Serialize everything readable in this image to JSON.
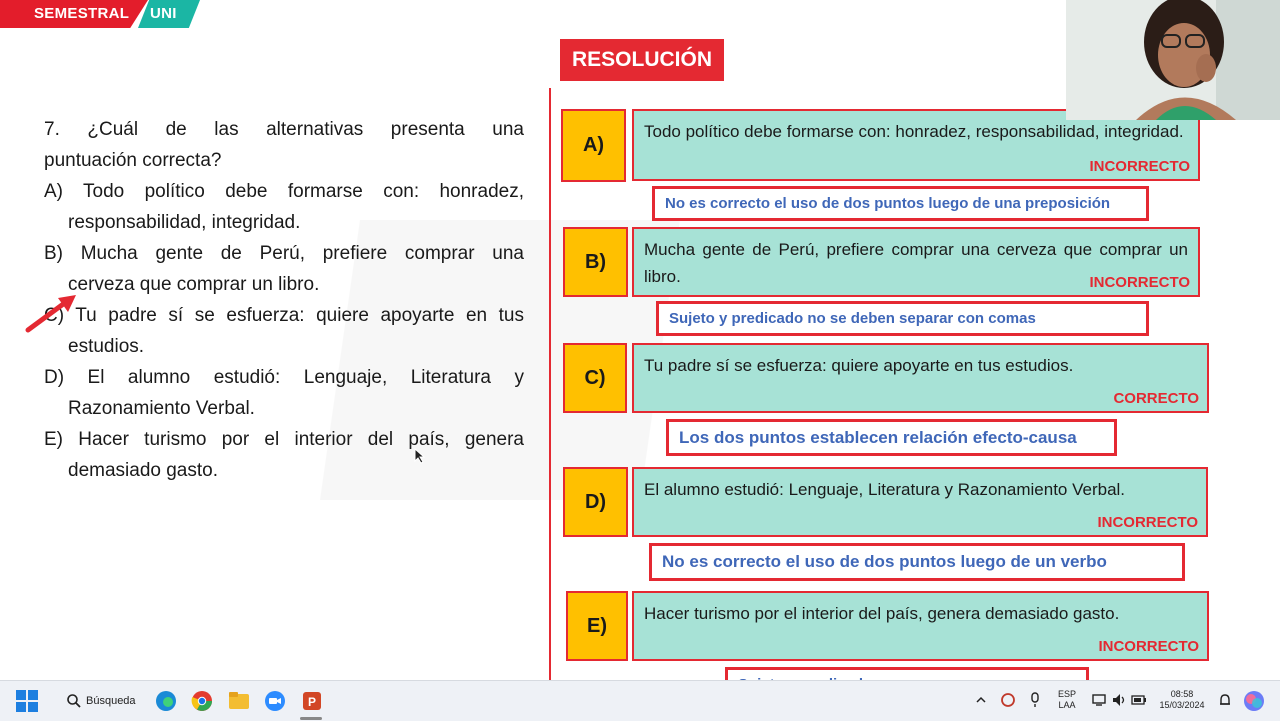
{
  "header": {
    "brand_left": "SEMESTRAL",
    "brand_right": "UNI"
  },
  "question": {
    "lines": [
      "7. ¿Cuál de las alternativas presenta una",
      "puntuación correcta?",
      "A) Todo político debe formarse con: honradez,",
      "responsabilidad, integridad.",
      "B) Mucha gente de Perú, prefiere comprar una",
      "cerveza que comprar un libro.",
      "C) Tu padre sí se esfuerza: quiere apoyarte en tus",
      "estudios.",
      "D) El alumno estudió: Lenguaje, Literatura y",
      "Razonamiento Verbal.",
      "E) Hacer turismo por el interior del país, genera",
      "demasiado gasto."
    ]
  },
  "resolution": {
    "title": "RESOLUCIÓN",
    "options": [
      {
        "letter": "A)",
        "text": "Todo político debe formarse con: honradez, responsabilidad, integridad.",
        "verdict": "INCORRECTO",
        "note": "No es correcto el uso de dos puntos luego de una preposición"
      },
      {
        "letter": "B)",
        "text": "Mucha gente de Perú, prefiere comprar una cerveza que comprar un libro.",
        "verdict": "INCORRECTO",
        "note": "Sujeto y predicado no se deben separar con comas"
      },
      {
        "letter": "C)",
        "text": "Tu padre sí se esfuerza: quiere apoyarte en tus estudios.",
        "verdict": "CORRECTO",
        "note": "Los dos puntos establecen relación efecto-causa"
      },
      {
        "letter": "D)",
        "text": "El alumno estudió: Lenguaje, Literatura y Razonamiento Verbal.",
        "verdict": "INCORRECTO",
        "note": "No es correcto el uso de dos puntos luego de un verbo"
      },
      {
        "letter": "E)",
        "text": "Hacer turismo por el interior del país, genera demasiado gasto.",
        "verdict": "INCORRECTO",
        "note": "Sujeto y predicado..."
      }
    ]
  },
  "taskbar": {
    "search_label": "Búsqueda",
    "language_top": "ESP",
    "language_bottom": "LAA",
    "time": "08:58",
    "date": "15/03/2024",
    "apps": [
      "edge-icon",
      "chrome-icon",
      "file-explorer-icon",
      "zoom-icon",
      "powerpoint-icon"
    ]
  },
  "colors": {
    "accent_red": "#e42932",
    "option_fill": "#a7e2d6",
    "letter_fill": "#ffc000",
    "note_text": "#3f67b8",
    "banner_teal": "#1bb6a4"
  }
}
